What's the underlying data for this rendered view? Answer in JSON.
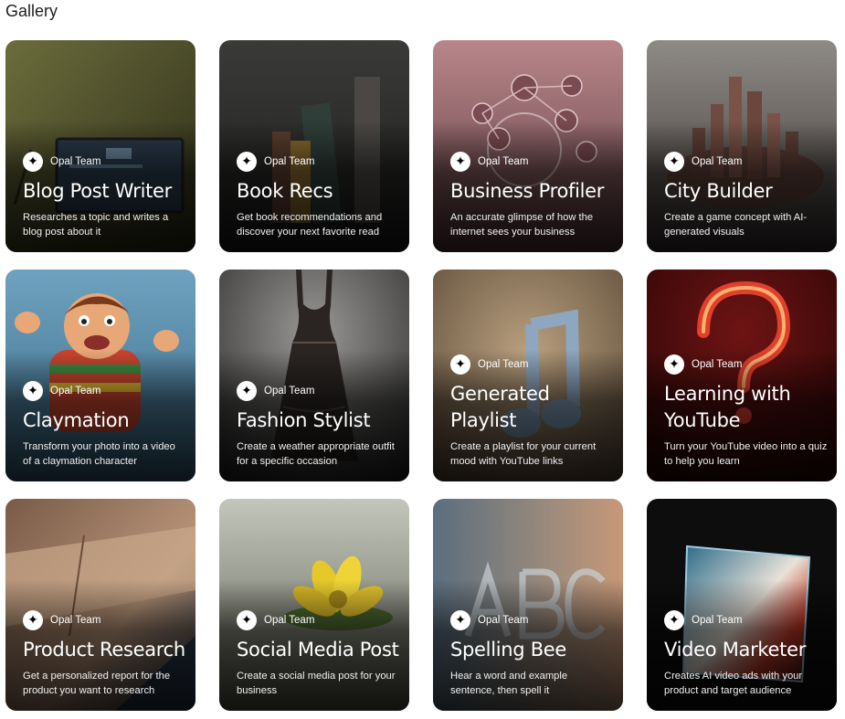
{
  "page": {
    "title": "Gallery"
  },
  "cards": [
    {
      "author": "Opal Team",
      "author_icon": "sparkle-icon",
      "title": "Blog Post Writer",
      "description": "Researches a topic and writes a blog post about it"
    },
    {
      "author": "Opal Team",
      "author_icon": "sparkle-icon",
      "title": "Book Recs",
      "description": "Get book recommendations and discover your next favorite read"
    },
    {
      "author": "Opal Team",
      "author_icon": "sparkle-icon",
      "title": "Business Profiler",
      "description": "An accurate glimpse of how the internet sees your business"
    },
    {
      "author": "Opal Team",
      "author_icon": "sparkle-icon",
      "title": "City Builder",
      "description": "Create a game concept with AI-generated visuals"
    },
    {
      "author": "Opal Team",
      "author_icon": "sparkle-icon",
      "title": "Claymation",
      "description": "Transform your photo into a video of a claymation character"
    },
    {
      "author": "Opal Team",
      "author_icon": "sparkle-icon",
      "title": "Fashion Stylist",
      "description": "Create a weather appropriate outfit for a specific occasion"
    },
    {
      "author": "Opal Team",
      "author_icon": "sparkle-icon",
      "title": "Generated Playlist",
      "description": "Create a playlist for your current mood with YouTube links"
    },
    {
      "author": "Opal Team",
      "author_icon": "sparkle-icon",
      "title": "Learning with YouTube",
      "description": "Turn your YouTube video into a quiz to help you learn"
    },
    {
      "author": "Opal Team",
      "author_icon": "sparkle-icon",
      "title": "Product Research",
      "description": "Get a personalized report for the product you want to research"
    },
    {
      "author": "Opal Team",
      "author_icon": "sparkle-icon",
      "title": "Social Media Post",
      "description": "Create a social media post for your business"
    },
    {
      "author": "Opal Team",
      "author_icon": "sparkle-icon",
      "title": "Spelling Bee",
      "description": "Hear a word and example sentence, then spell it"
    },
    {
      "author": "Opal Team",
      "author_icon": "sparkle-icon",
      "title": "Video Marketer",
      "description": "Creates AI video ads with your product and target audience"
    }
  ]
}
